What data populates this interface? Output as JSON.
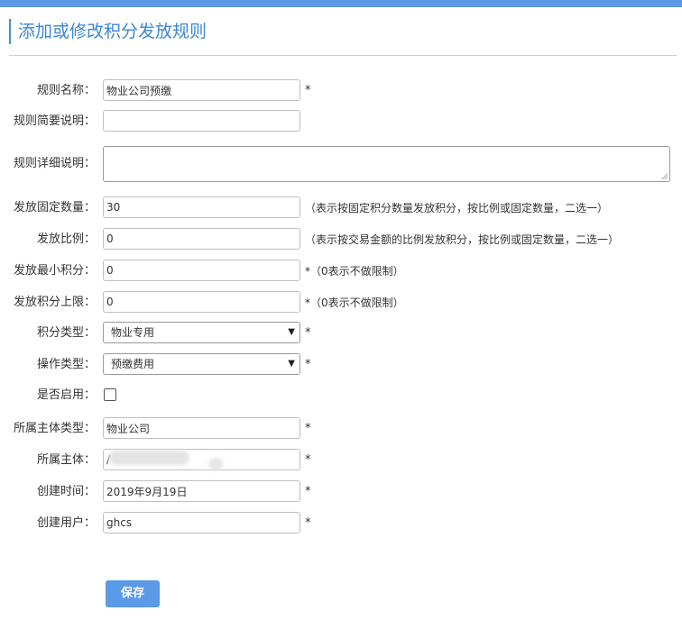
{
  "page": {
    "title": "添加或修改积分发放规则"
  },
  "form": {
    "colon": "：",
    "rule_name": {
      "label": "规则名称",
      "value": "物业公司预缴",
      "required": "*"
    },
    "rule_summary": {
      "label": "规则简要说明",
      "value": ""
    },
    "rule_detail": {
      "label": "规则详细说明",
      "value": ""
    },
    "fixed_quantity": {
      "label": "发放固定数量",
      "value": "30",
      "hint": "（表示按固定积分数量发放积分，按比例或固定数量，二选一）"
    },
    "ratio": {
      "label": "发放比例",
      "value": "0",
      "hint": "（表示按交易金额的比例发放积分，按比例或固定数量，二选一）"
    },
    "min_points": {
      "label": "发放最小积分",
      "value": "0",
      "hint": "*（0表示不做限制）"
    },
    "max_points": {
      "label": "发放积分上限",
      "value": "0",
      "hint": "*（0表示不做限制）"
    },
    "points_type": {
      "label": "积分类型",
      "selected": "物业专用",
      "required": "*"
    },
    "operation_type": {
      "label": "操作类型",
      "selected": "预缴费用",
      "required": "*"
    },
    "enabled": {
      "label": "是否启用",
      "checked": false
    },
    "entity_type": {
      "label": "所属主体类型",
      "value": "物业公司",
      "required": "*"
    },
    "entity": {
      "label": "所属主体",
      "value": "/",
      "required": "*"
    },
    "created_time": {
      "label": "创建时间",
      "value": "2019年9月19日",
      "required": "*"
    },
    "created_user": {
      "label": "创建用户",
      "value": "ghcs",
      "required": "*"
    }
  },
  "actions": {
    "save_label": "保存"
  },
  "colors": {
    "accent": "#5b9ae6",
    "title": "#3a87d6"
  }
}
